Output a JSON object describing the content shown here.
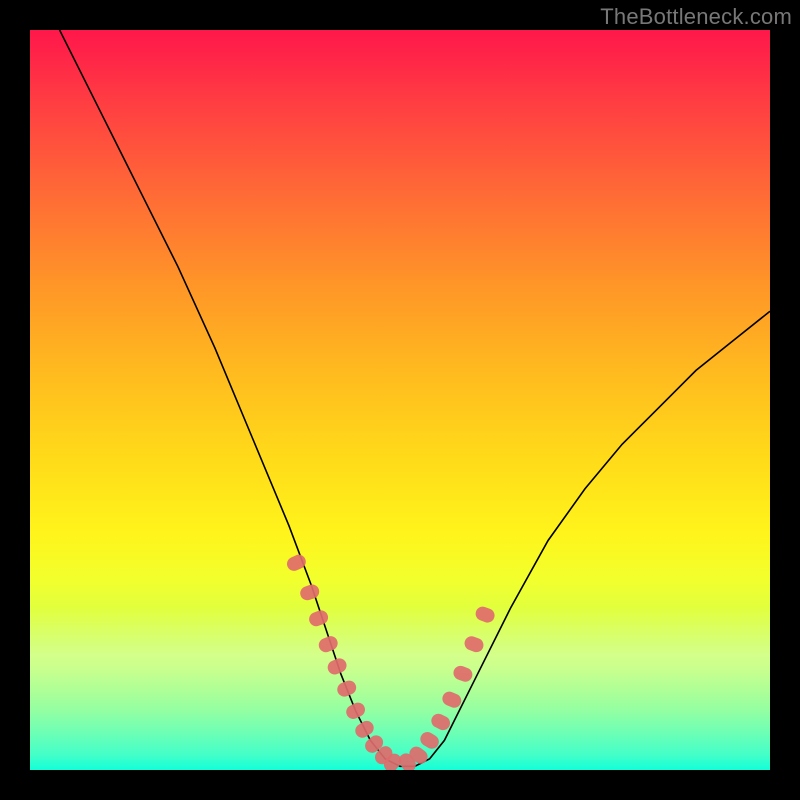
{
  "watermark": "TheBottleneck.com",
  "chart_data": {
    "type": "line",
    "title": "",
    "xlabel": "",
    "ylabel": "",
    "xlim": [
      0,
      100
    ],
    "ylim": [
      0,
      100
    ],
    "grid": false,
    "legend": false,
    "series": [
      {
        "name": "curve",
        "x": [
          4,
          10,
          15,
          20,
          25,
          30,
          35,
          38,
          40,
          42,
          44,
          46,
          48,
          50,
          52,
          54,
          56,
          60,
          65,
          70,
          75,
          80,
          85,
          90,
          95,
          100
        ],
        "y": [
          100,
          88,
          78,
          68,
          57,
          45,
          33,
          25,
          19,
          13,
          8,
          4,
          1.5,
          0.5,
          0.5,
          1.5,
          4,
          12,
          22,
          31,
          38,
          44,
          49,
          54,
          58,
          62
        ]
      },
      {
        "name": "marker-cluster-left",
        "x": [
          36,
          37.8,
          39,
          40.3,
          41.5,
          42.8,
          44,
          45.2,
          46.5,
          47.8,
          49
        ],
        "y": [
          28,
          24,
          20.5,
          17,
          14,
          11,
          8,
          5.5,
          3.5,
          2,
          1
        ]
      },
      {
        "name": "marker-cluster-right",
        "x": [
          51,
          52.5,
          54,
          55.5,
          57,
          58.5,
          60,
          61.5
        ],
        "y": [
          1,
          2,
          4,
          6.5,
          9.5,
          13,
          17,
          21
        ]
      }
    ],
    "colors": {
      "curve": "#000000",
      "marker": "#e06b6b"
    }
  }
}
